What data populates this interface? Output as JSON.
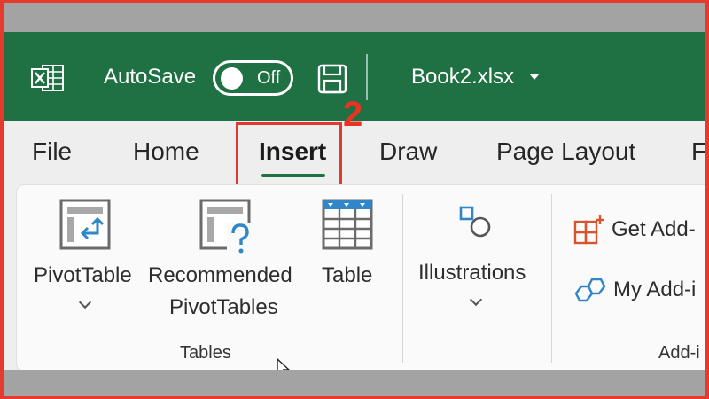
{
  "titlebar": {
    "autosave_label": "AutoSave",
    "autosave_state": "Off",
    "filename": "Book2.xlsx",
    "app_icon": "excel-icon",
    "brand_color": "#1f7144"
  },
  "tabs": [
    {
      "label": "File"
    },
    {
      "label": "Home"
    },
    {
      "label": "Insert"
    },
    {
      "label": "Draw"
    },
    {
      "label": "Page Layout"
    },
    {
      "label": "F"
    }
  ],
  "annotation": {
    "step_number": "2",
    "highlight_color": "#e03a2f"
  },
  "ribbon": {
    "tables_group": {
      "label": "Tables",
      "pivot_table": {
        "label": "PivotTable"
      },
      "recommended": {
        "line1": "Recommended",
        "line2": "PivotTables"
      },
      "table": {
        "label": "Table"
      }
    },
    "illustrations": {
      "label": "Illustrations"
    },
    "addins_group": {
      "label": "Add-i",
      "get_addins": "Get Add-",
      "my_addins": "My Add-i"
    }
  }
}
